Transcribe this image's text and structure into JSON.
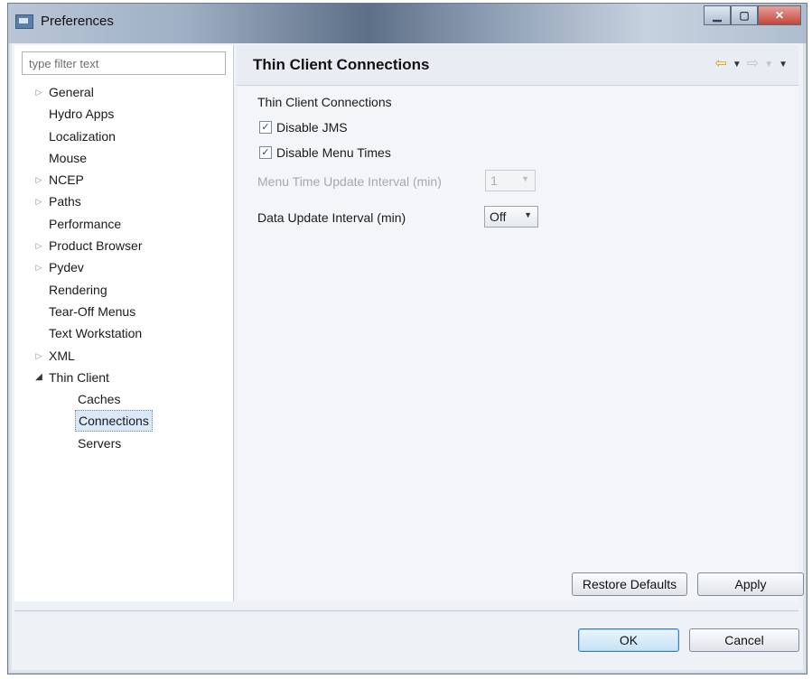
{
  "window": {
    "title": "Preferences"
  },
  "filter": {
    "placeholder": "type filter text"
  },
  "tree": {
    "items": [
      {
        "label": "General",
        "expandable": true
      },
      {
        "label": "Hydro Apps",
        "expandable": false
      },
      {
        "label": "Localization",
        "expandable": false
      },
      {
        "label": "Mouse",
        "expandable": false
      },
      {
        "label": "NCEP",
        "expandable": true
      },
      {
        "label": "Paths",
        "expandable": true
      },
      {
        "label": "Performance",
        "expandable": false
      },
      {
        "label": "Product Browser",
        "expandable": true
      },
      {
        "label": "Pydev",
        "expandable": true
      },
      {
        "label": "Rendering",
        "expandable": false
      },
      {
        "label": "Tear-Off Menus",
        "expandable": false
      },
      {
        "label": "Text Workstation",
        "expandable": false
      },
      {
        "label": "XML",
        "expandable": true
      },
      {
        "label": "Thin Client",
        "expanded": true
      },
      {
        "label": "Caches"
      },
      {
        "label": "Connections",
        "selected": true
      },
      {
        "label": "Servers"
      }
    ]
  },
  "page": {
    "header_title": "Thin Client Connections",
    "section_title": "Thin Client Connections",
    "disable_jms": {
      "label": "Disable JMS",
      "checked": true
    },
    "disable_menu_times": {
      "label": "Disable Menu Times",
      "checked": true
    },
    "menu_time_interval": {
      "label": "Menu Time Update Interval (min)",
      "value": "1",
      "enabled": false
    },
    "data_update_interval": {
      "label": "Data Update Interval (min)",
      "value": "Off"
    },
    "restore_defaults": "Restore Defaults",
    "apply": "Apply"
  },
  "dialog": {
    "ok": "OK",
    "cancel": "Cancel"
  },
  "colors": {
    "titlebar_dark": "#5d6f86",
    "selection": "#dbe8f6",
    "nav_back_arrow": "#d9a60f"
  }
}
